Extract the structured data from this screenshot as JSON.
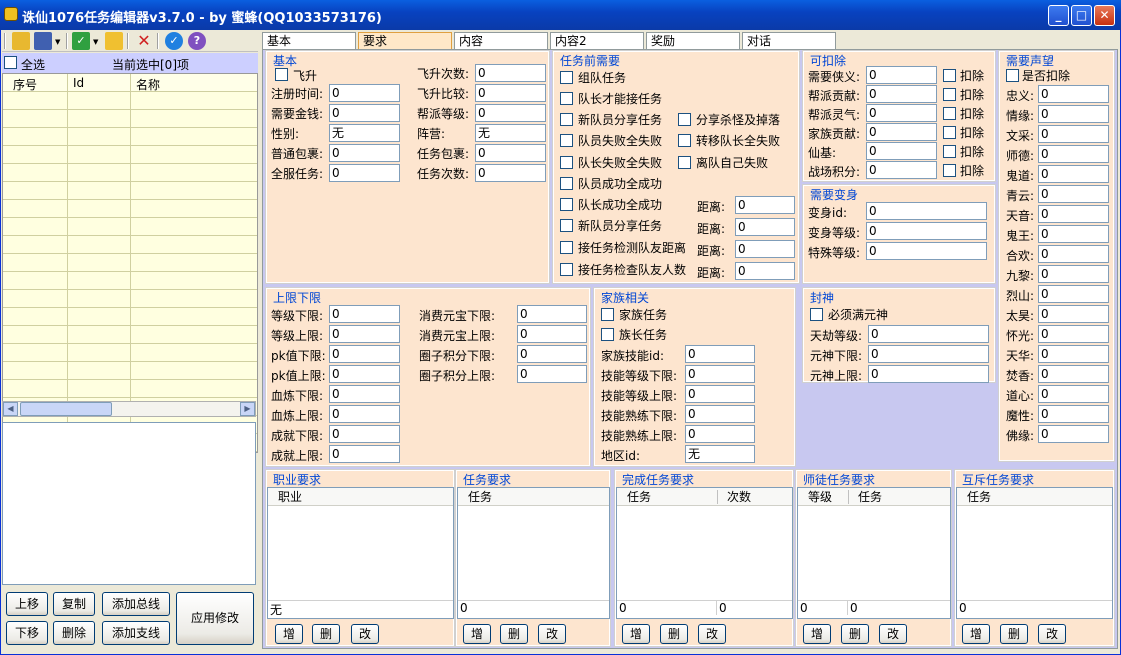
{
  "window": {
    "title": "诛仙1076任务编辑器v3.7.0  -  by 蜜蜂(QQ1033573176)",
    "min": "_",
    "max": "□",
    "close": "✕"
  },
  "left": {
    "select_all": "全选",
    "current": "当前选中[0]项",
    "col_seq": "序号",
    "col_id": "Id",
    "col_name": "名称",
    "btn_up": "上移",
    "btn_down": "下移",
    "btn_copy": "复制",
    "btn_delete": "删除",
    "btn_add_main": "添加总线",
    "btn_add_branch": "添加支线",
    "btn_apply": "应用修改"
  },
  "tabs": [
    "基本",
    "要求",
    "内容",
    "内容2",
    "奖励",
    "对话"
  ],
  "basic": {
    "title": "基本",
    "feisheng": "飞升",
    "reg_time": "注册时间:",
    "money": "需要金钱:",
    "gender": "性别:",
    "common_bag": "普通包裹:",
    "all_server": "全服任务:",
    "fs_count": "飞升次数:",
    "fs_compare": "飞升比较:",
    "faction_level": "帮派等级:",
    "camp": "阵营:",
    "task_bag": "任务包裹:",
    "task_times": "任务次数:",
    "v_reg_time": "0",
    "v_money": "0",
    "v_gender": "无",
    "v_common_bag": "0",
    "v_all_server": "0",
    "v_fs_count": "0",
    "v_fs_compare": "0",
    "v_faction_level": "0",
    "v_camp": "无",
    "v_task_bag": "0",
    "v_task_times": "0"
  },
  "pre": {
    "title": "任务前需要",
    "items": [
      "组队任务",
      "队长才能接任务",
      "新队员分享任务",
      "队员失败全失败",
      "队长失败全失败",
      "队员成功全成功",
      "队长成功全成功",
      "新队员分享任务",
      "接任务检测队友距离",
      "接任务检查队友人数"
    ],
    "right_items": [
      "分享杀怪及掉落",
      "转移队长全失败",
      "离队自己失败"
    ],
    "distance": "距离:",
    "d1": "0",
    "d2": "0",
    "d3": "0",
    "d4": "0"
  },
  "deduct": {
    "title": "可扣除",
    "labels": [
      "需要侠义:",
      "帮派贡献:",
      "帮派灵气:",
      "家族贡献:",
      "仙基:",
      "战场积分:"
    ],
    "values": [
      "0",
      "0",
      "0",
      "0",
      "0",
      "0"
    ],
    "deduct_label": "扣除"
  },
  "transform": {
    "title": "需要变身",
    "id": "变身id:",
    "level": "变身等级:",
    "special": "特殊等级:",
    "v_id": "0",
    "v_level": "0",
    "v_special": "0"
  },
  "fame": {
    "title": "需要声望",
    "is_deduct": "是否扣除",
    "labels": [
      "忠义:",
      "情缘:",
      "文采:",
      "师德:",
      "鬼道:",
      "青云:",
      "天音:",
      "鬼王:",
      "合欢:",
      "九黎:",
      "烈山:",
      "太昊:",
      "怀光:",
      "天华:",
      "焚香:",
      "道心:",
      "魔性:",
      "佛缘:"
    ],
    "values": [
      "0",
      "0",
      "0",
      "0",
      "0",
      "0",
      "0",
      "0",
      "0",
      "0",
      "0",
      "0",
      "0",
      "0",
      "0",
      "0",
      "0",
      "0"
    ]
  },
  "limits": {
    "title": "上限下限",
    "labels": [
      "等级下限:",
      "等级上限:",
      "pk值下限:",
      "pk值上限:",
      "血炼下限:",
      "血炼上限:",
      "成就下限:",
      "成就上限:"
    ],
    "values": [
      "0",
      "0",
      "0",
      "0",
      "0",
      "0",
      "0",
      "0"
    ],
    "right_labels": [
      "消费元宝下限:",
      "消费元宝上限:",
      "圈子积分下限:",
      "圈子积分上限:"
    ],
    "right_values": [
      "0",
      "0",
      "0",
      "0"
    ]
  },
  "family": {
    "title": "家族相关",
    "family_task": "家族任务",
    "leader_task": "族长任务",
    "labels": [
      "家族技能id:",
      "技能等级下限:",
      "技能等级上限:",
      "技能熟练下限:",
      "技能熟练上限:",
      "地区id:"
    ],
    "values": [
      "0",
      "0",
      "0",
      "0",
      "0",
      "无"
    ]
  },
  "fengshen": {
    "title": "封神",
    "must_full": "必须满元神",
    "labels": [
      "天劫等级:",
      "元神下限:",
      "元神上限:"
    ],
    "values": [
      "0",
      "0",
      "0"
    ]
  },
  "career": {
    "title": "职业要求",
    "col": "职业",
    "footer": "无"
  },
  "taskreq": {
    "title": "任务要求",
    "col": "任务",
    "footer": "0"
  },
  "complete": {
    "title": "完成任务要求",
    "col1": "任务",
    "col2": "次数",
    "footer1": "0",
    "footer2": "0"
  },
  "master": {
    "title": "师徒任务要求",
    "col1": "等级",
    "col2": "任务",
    "footer1": "0",
    "footer2": "0"
  },
  "mutex": {
    "title": "互斥任务要求",
    "col": "任务",
    "footer": "0"
  },
  "actions": {
    "add": "增",
    "del": "删",
    "edit": "改"
  }
}
